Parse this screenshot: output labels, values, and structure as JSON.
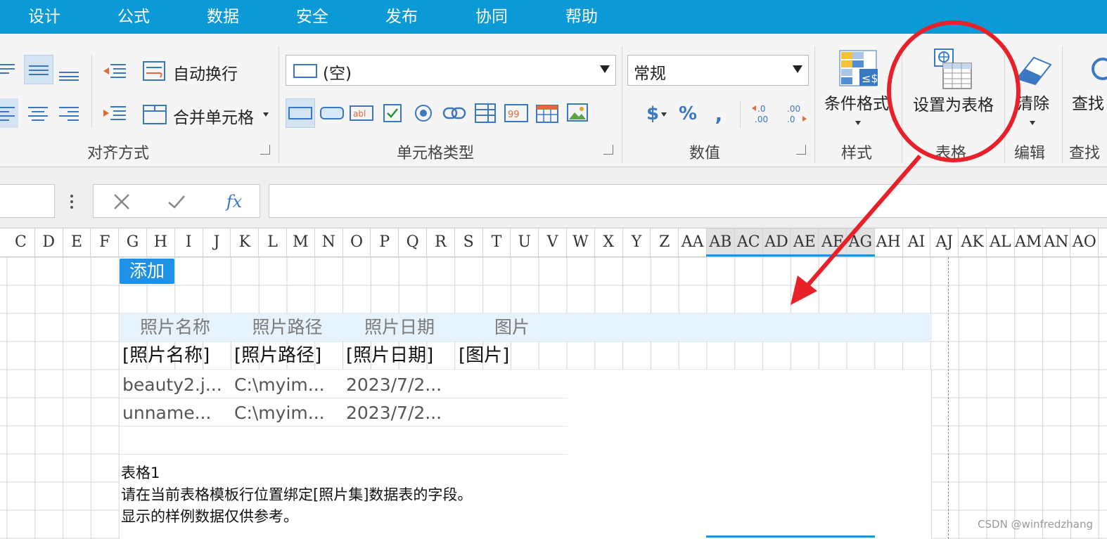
{
  "menu": [
    "设计",
    "公式",
    "数据",
    "安全",
    "发布",
    "协同",
    "帮助"
  ],
  "ribbon": {
    "alignment": {
      "wrap_text": "自动换行",
      "merge_cells": "合并单元格",
      "group_label": "对齐方式"
    },
    "cell_type": {
      "selected": "(空)",
      "group_label": "单元格类型"
    },
    "number": {
      "format": "常规",
      "currency": "$",
      "percent": "%",
      "comma": ",",
      "group_label": "数值"
    },
    "style": {
      "conditional_format": "条件格式",
      "group_label": "样式"
    },
    "table": {
      "set_as_table": "设置为表格",
      "group_label": "表格"
    },
    "edit": {
      "clear": "清除",
      "group_label": "编辑"
    },
    "find": {
      "find": "查找",
      "group_label": "查找"
    }
  },
  "formula_bar": {
    "fx": "fx"
  },
  "columns": [
    "C",
    "D",
    "E",
    "F",
    "G",
    "H",
    "I",
    "J",
    "K",
    "L",
    "M",
    "N",
    "O",
    "P",
    "Q",
    "R",
    "S",
    "T",
    "U",
    "V",
    "W",
    "X",
    "Y",
    "Z",
    "AA",
    "AB",
    "AC",
    "AD",
    "AE",
    "AF",
    "AG",
    "AH",
    "AI",
    "AJ",
    "AK",
    "AL",
    "AM",
    "AN",
    "AO"
  ],
  "highlighted_columns": [
    "AB",
    "AC",
    "AD",
    "AE",
    "AF",
    "AG"
  ],
  "sheet": {
    "add_button": "添加",
    "table_headers": [
      "照片名称",
      "照片路径",
      "照片日期",
      "图片"
    ],
    "template_row": [
      "[照片名称]",
      "[照片路径]",
      "[照片日期]",
      "[图片]"
    ],
    "data_rows": [
      [
        "beauty2.j...",
        "C:\\myim...",
        "2023/7/2..."
      ],
      [
        "unname...",
        "C:\\myim...",
        "2023/7/2..."
      ]
    ],
    "note_title": "表格1",
    "note_line1": "请在当前表格模板行位置绑定[照片集]数据表的字段。",
    "note_line2": "显示的样例数据仅供参考。"
  },
  "annotation_color": "#e8202a",
  "accent_color": "#0b9ad6",
  "watermark": "CSDN @winfredzhang"
}
